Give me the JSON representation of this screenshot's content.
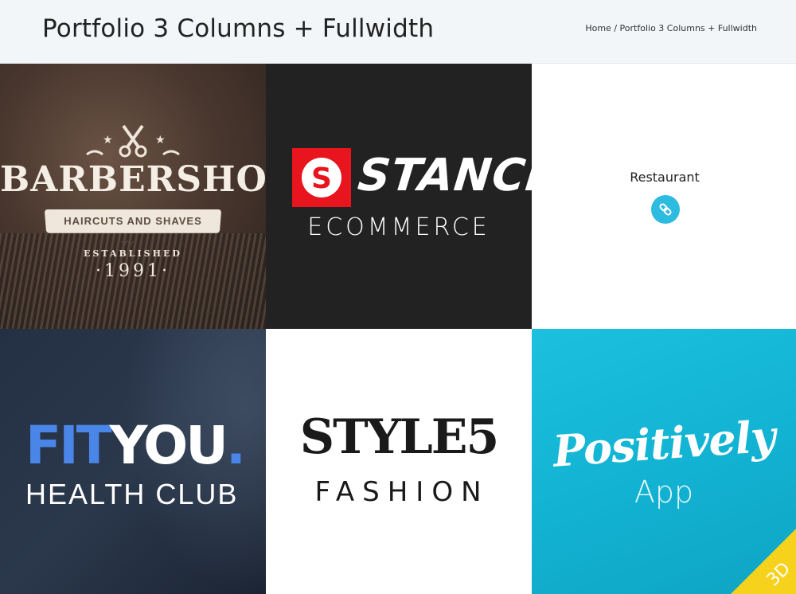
{
  "header": {
    "title": "Portfolio 3 Columns + Fullwidth",
    "breadcrumb": {
      "home": "Home",
      "separator": "/",
      "current": "Portfolio 3 Columns + Fullwidth"
    }
  },
  "portfolio": {
    "items": [
      {
        "brand": "BARBERSHOP",
        "tagline": "HAIRCUTS AND SHAVES",
        "established": "ESTABLISHED",
        "year": "·1991·"
      },
      {
        "brand": "STANCE",
        "logo_letter": "S",
        "tagline": "ECOMMERCE"
      },
      {
        "title": "Restaurant",
        "icon": "link-icon",
        "accent": "#2ebbe0"
      },
      {
        "brand_part1": "FIT",
        "brand_part2": "YOU",
        "brand_dot": ".",
        "tagline": "HEALTH CLUB"
      },
      {
        "brand": "STYLE5",
        "tagline": "FASHION"
      },
      {
        "brand": "Positively",
        "tagline": "App",
        "corner": "3D"
      }
    ]
  },
  "colors": {
    "header_bg": "#f2f6f8",
    "stance_red": "#e8141e",
    "fityou_blue": "#4a86e8",
    "positively_bg": "#12b2d2",
    "corner_yellow": "#f7d21c"
  }
}
